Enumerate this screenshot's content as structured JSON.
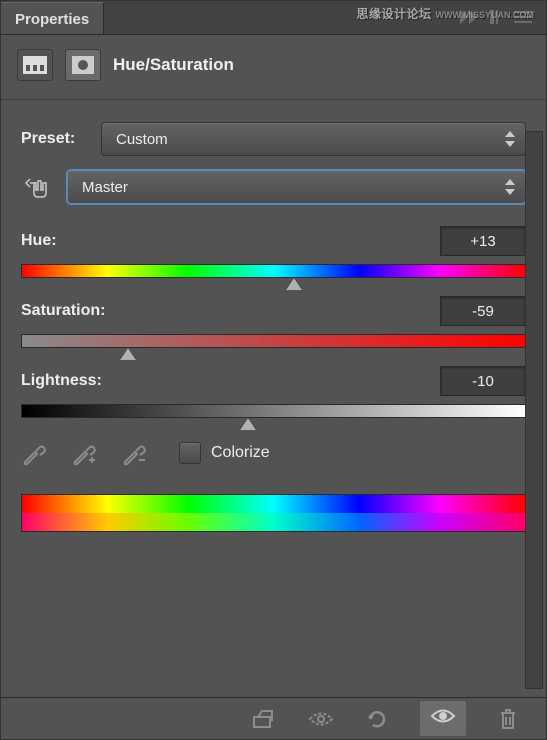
{
  "watermark": {
    "main": "思缘设计论坛",
    "sub": "WWW.MISSYUAN.COM"
  },
  "tab": {
    "label": "Properties"
  },
  "header": {
    "title": "Hue/Saturation"
  },
  "preset": {
    "label": "Preset:",
    "value": "Custom"
  },
  "range": {
    "value": "Master"
  },
  "hue": {
    "label": "Hue:",
    "value": "+13",
    "percent": 54
  },
  "saturation": {
    "label": "Saturation:",
    "value": "-59",
    "percent": 21
  },
  "lightness": {
    "label": "Lightness:",
    "value": "-10",
    "percent": 45
  },
  "colorize": {
    "label": "Colorize"
  }
}
